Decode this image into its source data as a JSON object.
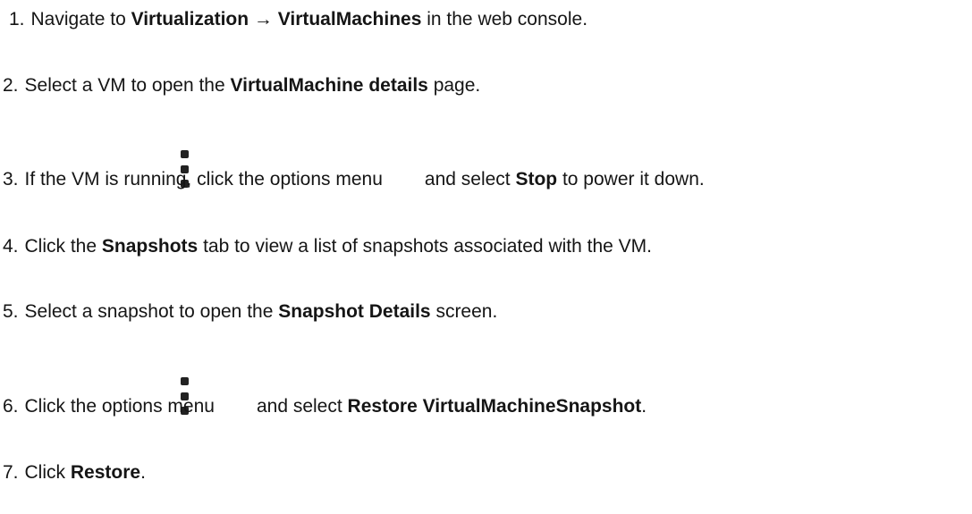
{
  "steps": [
    {
      "number": "1.",
      "parts": {
        "a": "Navigate to ",
        "b": "Virtualization → VirtualMachines",
        "c": " in the web console."
      }
    },
    {
      "number": "2.",
      "parts": {
        "a": "Select a VM to open the ",
        "b": "VirtualMachine details",
        "c": " page."
      }
    },
    {
      "number": "3.",
      "parts": {
        "a": "If the VM is running, click the options menu",
        "icon": "kebab-menu-icon",
        "b": "and select ",
        "c": "Stop",
        "d": " to power it down."
      }
    },
    {
      "number": "4.",
      "parts": {
        "a": "Click the ",
        "b": "Snapshots",
        "c": " tab to view a list of snapshots associated with the VM."
      }
    },
    {
      "number": "5.",
      "parts": {
        "a": "Select a snapshot to open the ",
        "b": "Snapshot Details",
        "c": " screen."
      }
    },
    {
      "number": "6.",
      "parts": {
        "a": "Click the options menu",
        "icon": "kebab-menu-icon",
        "b": "and select ",
        "c": "Restore VirtualMachineSnapshot",
        "d": "."
      }
    },
    {
      "number": "7.",
      "parts": {
        "a": "Click ",
        "b": "Restore",
        "c": "."
      }
    }
  ]
}
